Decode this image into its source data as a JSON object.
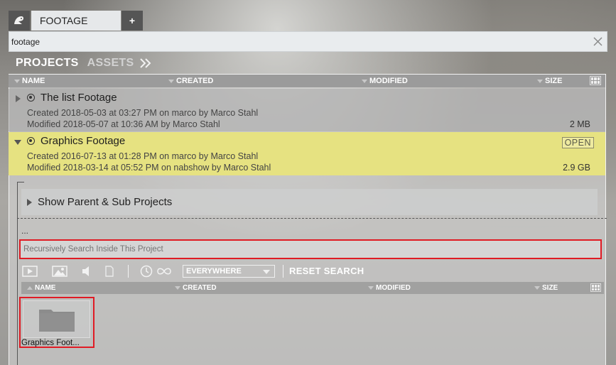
{
  "tabs": {
    "active_label": "FOOTAGE",
    "add_label": "+"
  },
  "search": {
    "value": "footage"
  },
  "nav": {
    "projects_label": "PROJECTS",
    "assets_label": "ASSETS"
  },
  "columns": {
    "name": "NAME",
    "created": "CREATED",
    "modified": "MODIFIED",
    "size": "SIZE"
  },
  "projects": [
    {
      "title": "The list Footage",
      "created_line": "Created  2018-05-03 at 03:27 PM on marco by Marco Stahl",
      "modified_line": "Modified 2018-05-07 at 10:36 AM by Marco Stahl",
      "size": "2 MB",
      "expanded": false
    },
    {
      "title": "Graphics Footage",
      "created_line": "Created  2016-07-13 at 01:28 PM on marco by Marco Stahl",
      "modified_line": "Modified 2018-03-14 at 05:52 PM on nabshow by Marco Stahl",
      "size": "2.9 GB",
      "badge": "OPEN",
      "expanded": true
    }
  ],
  "detail": {
    "parent_sub_label": "Show Parent & Sub Projects",
    "path_text": "...",
    "recursive_search_placeholder": "Recursively Search Inside This Project",
    "scope_value": "EVERYWHERE",
    "reset_label": "RESET SEARCH"
  },
  "asset_columns": {
    "name": "NAME",
    "created": "CREATED",
    "modified": "MODIFIED",
    "size": "SIZE"
  },
  "assets": [
    {
      "name": "Graphics Foot...",
      "icon": "folder-icon"
    }
  ],
  "colors": {
    "selected_row": "#e6e281",
    "highlight_border": "#e01b24"
  }
}
